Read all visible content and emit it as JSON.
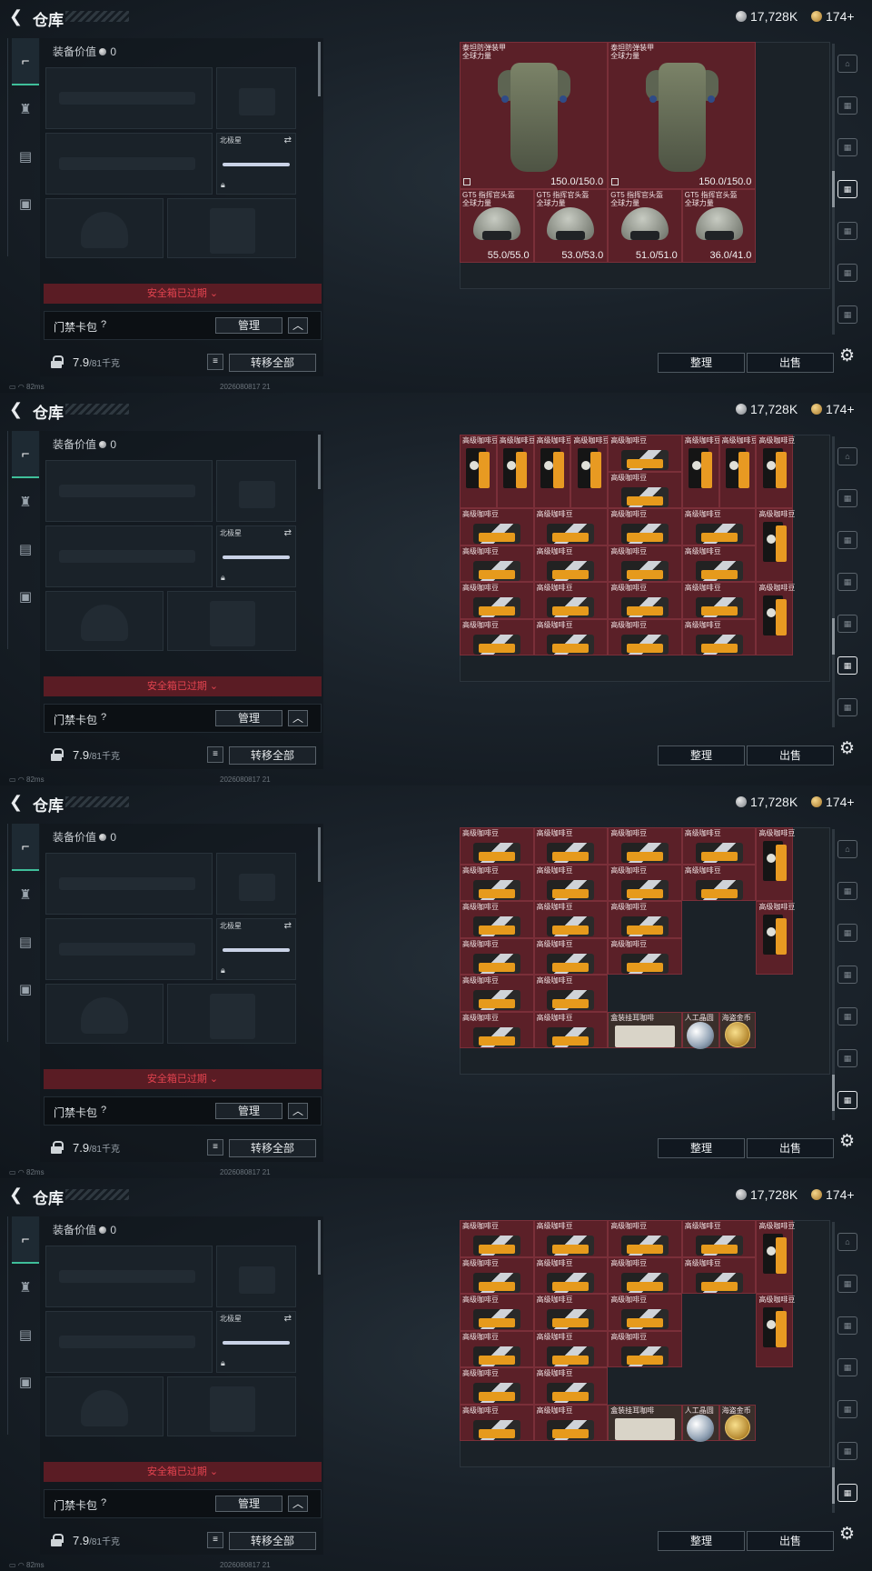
{
  "header": {
    "title": "仓库",
    "silver": "17,728K",
    "gold": "174+"
  },
  "equip": {
    "value_label": "装备价值",
    "value": "0",
    "melee_label": "北极星",
    "safe_expired": "安全箱已过期",
    "card_label": "门禁卡包",
    "help": "?",
    "manage": "管理",
    "weight": "7.9",
    "weight_max": "/81千克",
    "transfer_all": "转移全部"
  },
  "status": {
    "ping": "82ms",
    "code": "2026080817 21"
  },
  "buttons": {
    "sort": "整理",
    "sell": "出售"
  },
  "panels": [
    {
      "grid_kind": "armor",
      "items": [
        {
          "kind": "vest",
          "label": "泰坦防弹装甲\n全球力量",
          "value": "150.0/150.0",
          "c": 0,
          "r": 0,
          "w": 2,
          "h": 4
        },
        {
          "kind": "vest",
          "label": "泰坦防弹装甲\n全球力量",
          "value": "150.0/150.0",
          "c": 2,
          "r": 0,
          "w": 2,
          "h": 4
        },
        {
          "kind": "helm",
          "label": "GT5 指挥官头盔\n全球力量",
          "value": "55.0/55.0",
          "c": 0,
          "r": 4,
          "w": 1,
          "h": 2
        },
        {
          "kind": "helm",
          "label": "GT5 指挥官头盔\n全球力量",
          "value": "53.0/53.0",
          "c": 1,
          "r": 4,
          "w": 1,
          "h": 2
        },
        {
          "kind": "helm",
          "label": "GT5 指挥官头盔\n全球力量",
          "value": "51.0/51.0",
          "c": 2,
          "r": 4,
          "w": 1,
          "h": 2
        },
        {
          "kind": "helm",
          "label": "GT5 指挥官头盔\n全球力量",
          "value": "36.0/41.0",
          "c": 3,
          "r": 4,
          "w": 1,
          "h": 2
        }
      ]
    },
    {
      "grid_kind": "coffee1",
      "items": [
        {
          "kind": "bag",
          "label": "高级咖啡豆",
          "c": 0,
          "r": 0,
          "w": 0.5,
          "h": 2
        },
        {
          "kind": "bag",
          "label": "高级咖啡豆",
          "c": 0.5,
          "r": 0,
          "w": 0.5,
          "h": 2
        },
        {
          "kind": "bag",
          "label": "高级咖啡豆",
          "c": 1,
          "r": 0,
          "w": 0.5,
          "h": 2
        },
        {
          "kind": "bag",
          "label": "高级咖啡豆",
          "c": 1.5,
          "r": 0,
          "w": 0.5,
          "h": 2
        },
        {
          "kind": "coffee",
          "label": "高级咖啡豆",
          "c": 2,
          "r": 0,
          "w": 1,
          "h": 1
        },
        {
          "kind": "coffee",
          "label": "高级咖啡豆",
          "c": 2,
          "r": 1,
          "w": 1,
          "h": 1
        },
        {
          "kind": "bag",
          "label": "高级咖啡豆",
          "c": 3,
          "r": 0,
          "w": 0.5,
          "h": 2
        },
        {
          "kind": "bag",
          "label": "高级咖啡豆",
          "c": 3.5,
          "r": 0,
          "w": 0.5,
          "h": 2
        },
        {
          "kind": "bag",
          "label": "高级咖啡豆",
          "c": 4,
          "r": 0,
          "w": 0.5,
          "h": 2
        },
        {
          "kind": "coffee",
          "label": "高级咖啡豆",
          "c": 0,
          "r": 2,
          "w": 1,
          "h": 1
        },
        {
          "kind": "coffee",
          "label": "高级咖啡豆",
          "c": 1,
          "r": 2,
          "w": 1,
          "h": 1
        },
        {
          "kind": "coffee",
          "label": "高级咖啡豆",
          "c": 2,
          "r": 2,
          "w": 1,
          "h": 1
        },
        {
          "kind": "coffee",
          "label": "高级咖啡豆",
          "c": 3,
          "r": 2,
          "w": 1,
          "h": 1
        },
        {
          "kind": "bag",
          "label": "高级咖啡豆",
          "c": 4,
          "r": 2,
          "w": 0.5,
          "h": 2
        },
        {
          "kind": "coffee",
          "label": "高级咖啡豆",
          "c": 0,
          "r": 3,
          "w": 1,
          "h": 1
        },
        {
          "kind": "coffee",
          "label": "高级咖啡豆",
          "c": 1,
          "r": 3,
          "w": 1,
          "h": 1
        },
        {
          "kind": "coffee",
          "label": "高级咖啡豆",
          "c": 2,
          "r": 3,
          "w": 1,
          "h": 1
        },
        {
          "kind": "coffee",
          "label": "高级咖啡豆",
          "c": 3,
          "r": 3,
          "w": 1,
          "h": 1
        },
        {
          "kind": "coffee",
          "label": "高级咖啡豆",
          "c": 0,
          "r": 4,
          "w": 1,
          "h": 1
        },
        {
          "kind": "coffee",
          "label": "高级咖啡豆",
          "c": 1,
          "r": 4,
          "w": 1,
          "h": 1
        },
        {
          "kind": "coffee",
          "label": "高级咖啡豆",
          "c": 2,
          "r": 4,
          "w": 1,
          "h": 1
        },
        {
          "kind": "coffee",
          "label": "高级咖啡豆",
          "c": 3,
          "r": 4,
          "w": 1,
          "h": 1
        },
        {
          "kind": "bag",
          "label": "高级咖啡豆",
          "c": 4,
          "r": 4,
          "w": 0.5,
          "h": 2
        },
        {
          "kind": "coffee",
          "label": "高级咖啡豆",
          "c": 0,
          "r": 5,
          "w": 1,
          "h": 1
        },
        {
          "kind": "coffee",
          "label": "高级咖啡豆",
          "c": 1,
          "r": 5,
          "w": 1,
          "h": 1
        },
        {
          "kind": "coffee",
          "label": "高级咖啡豆",
          "c": 2,
          "r": 5,
          "w": 1,
          "h": 1
        },
        {
          "kind": "coffee",
          "label": "高级咖啡豆",
          "c": 3,
          "r": 5,
          "w": 1,
          "h": 1
        }
      ]
    },
    {
      "grid_kind": "coffee2",
      "items": [
        {
          "kind": "coffee",
          "label": "高级咖啡豆",
          "c": 0,
          "r": 0,
          "w": 1,
          "h": 1
        },
        {
          "kind": "coffee",
          "label": "高级咖啡豆",
          "c": 1,
          "r": 0,
          "w": 1,
          "h": 1
        },
        {
          "kind": "coffee",
          "label": "高级咖啡豆",
          "c": 2,
          "r": 0,
          "w": 1,
          "h": 1
        },
        {
          "kind": "coffee",
          "label": "高级咖啡豆",
          "c": 3,
          "r": 0,
          "w": 1,
          "h": 1
        },
        {
          "kind": "bag",
          "label": "高级咖啡豆",
          "c": 4,
          "r": 0,
          "w": 0.5,
          "h": 2
        },
        {
          "kind": "coffee",
          "label": "高级咖啡豆",
          "c": 0,
          "r": 1,
          "w": 1,
          "h": 1
        },
        {
          "kind": "coffee",
          "label": "高级咖啡豆",
          "c": 1,
          "r": 1,
          "w": 1,
          "h": 1
        },
        {
          "kind": "coffee",
          "label": "高级咖啡豆",
          "c": 2,
          "r": 1,
          "w": 1,
          "h": 1
        },
        {
          "kind": "coffee",
          "label": "高级咖啡豆",
          "c": 3,
          "r": 1,
          "w": 1,
          "h": 1
        },
        {
          "kind": "coffee",
          "label": "高级咖啡豆",
          "c": 0,
          "r": 2,
          "w": 1,
          "h": 1
        },
        {
          "kind": "coffee",
          "label": "高级咖啡豆",
          "c": 1,
          "r": 2,
          "w": 1,
          "h": 1
        },
        {
          "kind": "coffee",
          "label": "高级咖啡豆",
          "c": 2,
          "r": 2,
          "w": 1,
          "h": 1
        },
        {
          "kind": "bag",
          "label": "高级咖啡豆",
          "c": 4,
          "r": 2,
          "w": 0.5,
          "h": 2
        },
        {
          "kind": "coffee",
          "label": "高级咖啡豆",
          "c": 0,
          "r": 3,
          "w": 1,
          "h": 1
        },
        {
          "kind": "coffee",
          "label": "高级咖啡豆",
          "c": 1,
          "r": 3,
          "w": 1,
          "h": 1
        },
        {
          "kind": "coffee",
          "label": "高级咖啡豆",
          "c": 2,
          "r": 3,
          "w": 1,
          "h": 1
        },
        {
          "kind": "coffee",
          "label": "高级咖啡豆",
          "c": 0,
          "r": 4,
          "w": 1,
          "h": 1
        },
        {
          "kind": "coffee",
          "label": "高级咖啡豆",
          "c": 1,
          "r": 4,
          "w": 1,
          "h": 1
        },
        {
          "kind": "coffee",
          "label": "高级咖啡豆",
          "c": 0,
          "r": 5,
          "w": 1,
          "h": 1
        },
        {
          "kind": "coffee",
          "label": "高级咖啡豆",
          "c": 1,
          "r": 5,
          "w": 1,
          "h": 1
        },
        {
          "kind": "box",
          "label": "盒装挂耳咖啡",
          "c": 2,
          "r": 5,
          "w": 1,
          "h": 1
        },
        {
          "kind": "crys",
          "label": "人工晶圆",
          "c": 3,
          "r": 5,
          "w": 0.5,
          "h": 1
        },
        {
          "kind": "gold",
          "label": "海盗金币",
          "c": 3.5,
          "r": 5,
          "w": 0.5,
          "h": 1
        }
      ]
    },
    {
      "grid_kind": "coffee2",
      "copy_of": 2
    }
  ],
  "colors": {
    "accent": "#3fbf9a",
    "danger": "#e2434f",
    "item_bg": "#5b2028"
  }
}
